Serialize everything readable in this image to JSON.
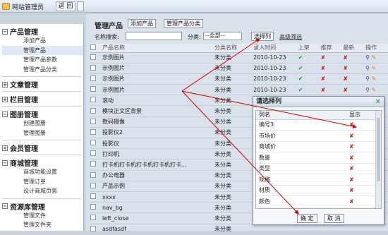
{
  "topbar": {
    "user": "网站管理员",
    "back": "返 回"
  },
  "sidebar": {
    "groups": [
      {
        "title": "产品管理",
        "toggle": "−",
        "items": [
          "添加产品",
          "管理产品",
          "管理产品参数",
          "管理产品分类"
        ]
      },
      {
        "title": "文章管理",
        "toggle": "+",
        "items": []
      },
      {
        "title": "栏目管理",
        "toggle": "+",
        "items": []
      },
      {
        "title": "图册管理",
        "toggle": "−",
        "items": [
          "创建图册",
          "管理图册"
        ]
      },
      {
        "title": "会员管理",
        "toggle": "+",
        "items": []
      },
      {
        "title": "商城管理",
        "toggle": "−",
        "items": [
          "商城功能设置",
          "管理订单",
          "设计商城页面"
        ]
      },
      {
        "title": "资源库管理",
        "toggle": "−",
        "items": [
          "管理文件",
          "管理文件夹"
        ]
      }
    ],
    "active_item": "管理产品"
  },
  "main": {
    "title": "管理产品",
    "add_button": "添加产品",
    "manage_category_button": "管理产品分类",
    "search_label": "名称搜索:",
    "category_label": "分类:",
    "category_selected": "--全部--",
    "select_columns_button": "选择列",
    "advanced_filter": "高级筛选",
    "columns": [
      "产品名称",
      "分类名称",
      "录入时间",
      "上架",
      "推荐",
      "最新",
      "操作"
    ],
    "rows": [
      {
        "name": "示例图片",
        "category": "未分类",
        "date": "2010-10-23",
        "up": "✔",
        "rec": "✘",
        "new": "✘"
      },
      {
        "name": "示例图片",
        "category": "未分类",
        "date": "2010-10-23",
        "up": "✔",
        "rec": "✘",
        "new": "✘"
      },
      {
        "name": "示例图片",
        "category": "未分类",
        "date": "2010-10-23",
        "up": "✔",
        "rec": "✘",
        "new": "✘"
      },
      {
        "name": "示例图片",
        "category": "未分类",
        "date": "2010-10-23",
        "up": "✔",
        "rec": "✘",
        "new": "✘"
      },
      {
        "name": "滚动",
        "category": "未分类",
        "date": "",
        "up": "",
        "rec": "",
        "new": ""
      },
      {
        "name": "模块正文区背景",
        "category": "未分类",
        "date": "",
        "up": "",
        "rec": "",
        "new": ""
      },
      {
        "name": "数码摄像",
        "category": "未分类",
        "date": "",
        "up": "",
        "rec": "",
        "new": ""
      },
      {
        "name": "投影仪2",
        "category": "未分类",
        "date": "",
        "up": "",
        "rec": "",
        "new": ""
      },
      {
        "name": "投影仪",
        "category": "未分类",
        "date": "",
        "up": "",
        "rec": "",
        "new": ""
      },
      {
        "name": "打印机",
        "category": "未分类",
        "date": "",
        "up": "",
        "rec": "",
        "new": ""
      },
      {
        "name": "打卡机打卡机打卡机打卡机打卡...",
        "category": "未分类",
        "date": "",
        "up": "",
        "rec": "",
        "new": ""
      },
      {
        "name": "办公电器",
        "category": "未分类",
        "date": "",
        "up": "",
        "rec": "",
        "new": ""
      },
      {
        "name": "产品示例",
        "category": "未分类",
        "date": "",
        "up": "",
        "rec": "",
        "new": ""
      },
      {
        "name": "xxxx",
        "category": "未分类",
        "date": "",
        "up": "",
        "rec": "",
        "new": ""
      },
      {
        "name": "nav_bg",
        "category": "未分类",
        "date": "",
        "up": "",
        "rec": "",
        "new": ""
      },
      {
        "name": "left_close",
        "category": "未分类",
        "date": "",
        "up": "",
        "rec": "",
        "new": ""
      },
      {
        "name": "asdfasdf",
        "category": "未分类",
        "date": "",
        "up": "",
        "rec": "",
        "new": ""
      }
    ]
  },
  "dialog": {
    "title": "请选择列",
    "close": "✕",
    "col_name": "列名",
    "col_show": "显示",
    "items": [
      "编号3",
      "市场价",
      "商城价",
      "数量",
      "类型",
      "规格",
      "材质",
      "颜色"
    ],
    "confirm": "确 定",
    "cancel": "取 消"
  },
  "colors": {
    "arrow": "#d00000",
    "check": "#1a9a22",
    "cross": "#cc1d1d"
  }
}
